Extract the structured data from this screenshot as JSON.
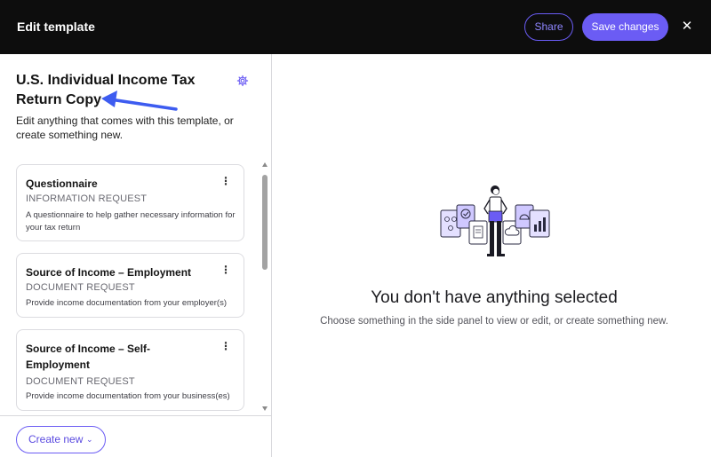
{
  "header": {
    "title": "Edit template",
    "share_label": "Share",
    "save_label": "Save changes",
    "close_glyph": "✕"
  },
  "sidebar": {
    "template_title": "U.S. Individual Income Tax Return Copy",
    "template_description": "Edit anything that comes with this template, or create something new.",
    "items": [
      {
        "title": "Questionnaire",
        "type": "INFORMATION REQUEST",
        "description": "A questionnaire to help gather necessary information for your tax return"
      },
      {
        "title": "Source of Income – Employment",
        "type": "DOCUMENT REQUEST",
        "description": "Provide income documentation from your employer(s)"
      },
      {
        "title": "Source of Income – Self-Employment",
        "type": "DOCUMENT REQUEST",
        "description": "Provide income documentation from your business(es)"
      }
    ],
    "create_label": "Create new",
    "menu_glyph": "⋮",
    "chevron_glyph": "⌄"
  },
  "main": {
    "empty_title": "You don't have anything selected",
    "empty_subtitle": "Choose something in the side panel to view or edit, or create something new."
  },
  "icons": {
    "settings": "gear-icon",
    "annotation": "arrow-annotation-icon",
    "close": "close-icon",
    "menu": "kebab-menu-icon",
    "chevron": "chevron-down-icon"
  },
  "colors": {
    "accent": "#6b5cf4",
    "topbar": "#0d0d0d",
    "arrow": "#3d5cf0"
  }
}
